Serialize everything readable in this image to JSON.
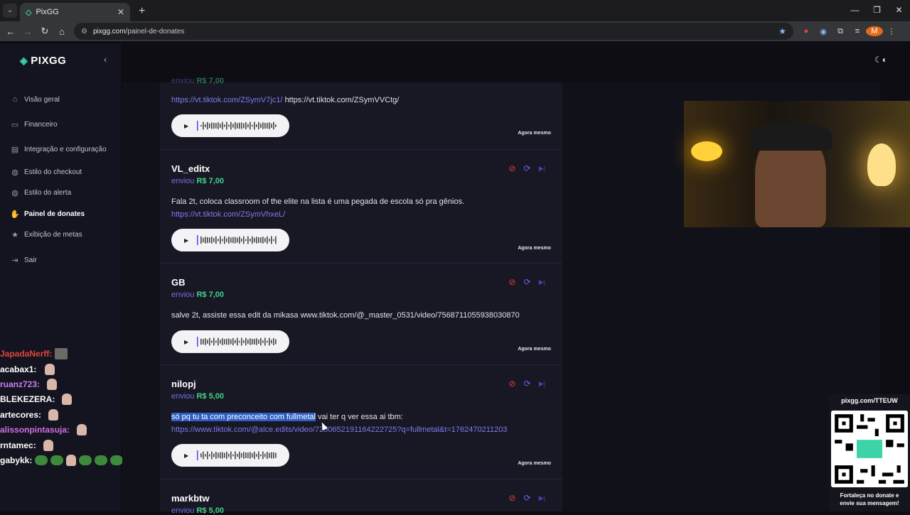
{
  "browser": {
    "tab_title": "PixGG",
    "url_domain": "pixgg.com",
    "url_path": "/painel-de-donates",
    "profile_initial": "M"
  },
  "sidebar": {
    "brand": "PIXGG",
    "items": [
      {
        "label": "Visão geral",
        "icon": "home-icon"
      },
      {
        "label": "Financeiro",
        "icon": "wallet-icon"
      },
      {
        "label": "Integração e configuração",
        "icon": "doc-icon"
      },
      {
        "label": "Estilo do checkout",
        "icon": "palette-icon"
      },
      {
        "label": "Estilo do alerta",
        "icon": "palette-icon"
      },
      {
        "label": "Painel de donates",
        "icon": "hand-coin-icon"
      },
      {
        "label": "Exibição de metas",
        "icon": "star-icon"
      },
      {
        "label": "Sair",
        "icon": "logout-icon"
      }
    ]
  },
  "chat": [
    {
      "user": "JapadaNerff:",
      "color": "#e0443c"
    },
    {
      "user": "acabax1:",
      "color": "#ffffff"
    },
    {
      "user": "ruanz723:",
      "color": "#c87df0"
    },
    {
      "user": "BLEKEZERA:",
      "color": "#ffffff"
    },
    {
      "user": "artecores:",
      "color": "#ffffff"
    },
    {
      "user": "alissonpintasuja:",
      "color": "#d070e0"
    },
    {
      "user": "rntamec:",
      "color": "#ffffff"
    },
    {
      "user": "gabykk:",
      "color": "#ffffff"
    }
  ],
  "donates": [
    {
      "name": "",
      "verb": "enviou",
      "amount": "R$ 7,00",
      "link": "https://vt.tiktok.com/ZSymV7jc1/",
      "link_plain": "https://vt.tiktok.com/ZSymVVCtg/",
      "time": "Agora mesmo"
    },
    {
      "name": "VL_editx",
      "verb": "enviou",
      "amount": "R$ 7,00",
      "message": "Fala 2t, coloca classroom of the elite na lista é uma pegada de escola só pra gênios.",
      "link": "https://vt.tiktok.com/ZSymVhxeL/",
      "time": "Agora mesmo"
    },
    {
      "name": "GB",
      "verb": "enviou",
      "amount": "R$ 7,00",
      "message": "salve 2t, assiste essa edit da mikasa www.tiktok.com/@_master_0531/video/7568711055938030870",
      "time": "Agora mesmo"
    },
    {
      "name": "nilopj",
      "verb": "enviou",
      "amount": "R$ 5,00",
      "message_highlight": "só pq tu ta com preconceito com fullmetal",
      "message_rest": " vai ter q ver essa ai tbm:",
      "link": "https://www.tiktok.com/@alce.edits/video/7250652191164222725?q=fullmetal&t=1762470211203",
      "time": "Agora mesmo"
    },
    {
      "name": "markbtw",
      "verb": "enviou",
      "amount": "R$ 5,00"
    }
  ],
  "qr": {
    "url": "pixgg.com/TTEUW",
    "caption_line1": "Fortaleça no donate e",
    "caption_line2": "envie sua mensagem!"
  }
}
